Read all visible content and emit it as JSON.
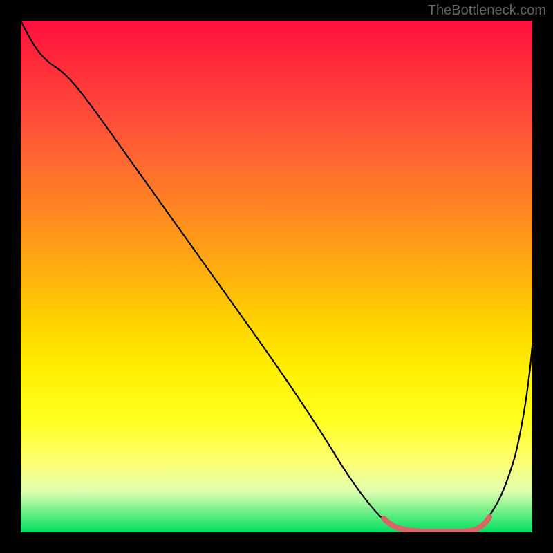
{
  "attribution": "TheBottleneck.com",
  "chart_data": {
    "type": "line",
    "title": "",
    "xlabel": "",
    "ylabel": "",
    "xlim": [
      0,
      100
    ],
    "ylim": [
      0,
      100
    ],
    "grid": false,
    "series": [
      {
        "name": "bottleneck-curve",
        "x": [
          0,
          4,
          10,
          20,
          30,
          40,
          50,
          60,
          65,
          70,
          75,
          80,
          85,
          90,
          95,
          100
        ],
        "y": [
          100,
          94,
          90,
          77,
          65,
          52,
          40,
          25,
          15,
          6,
          1,
          0,
          0,
          5,
          20,
          40
        ],
        "color": "#000000"
      },
      {
        "name": "optimal-range",
        "x": [
          70,
          75,
          80,
          85,
          90
        ],
        "y": [
          6,
          1,
          0,
          0,
          5
        ],
        "color": "#dd6666"
      }
    ],
    "gradient_stops": [
      {
        "pos": 0,
        "color": "#ff1040"
      },
      {
        "pos": 50,
        "color": "#ffd000"
      },
      {
        "pos": 85,
        "color": "#ffff70"
      },
      {
        "pos": 100,
        "color": "#00e060"
      }
    ]
  }
}
